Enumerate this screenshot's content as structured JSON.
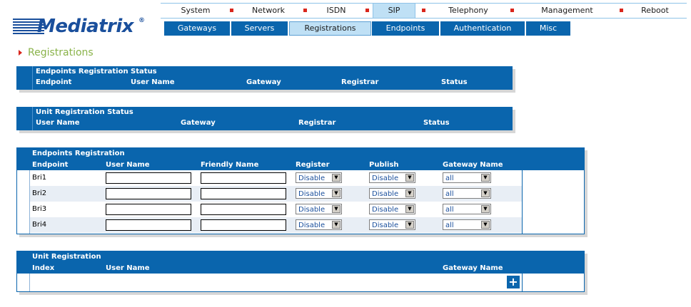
{
  "logo": {
    "text": "Mediatrix",
    "reg": "®"
  },
  "top_menu": [
    {
      "label": "System"
    },
    {
      "label": "Network"
    },
    {
      "label": "ISDN"
    },
    {
      "label": "SIP"
    },
    {
      "label": "Telephony"
    },
    {
      "label": "Management"
    },
    {
      "label": "Reboot"
    }
  ],
  "top_menu_active": "SIP",
  "sub_menu": [
    {
      "label": "Gateways"
    },
    {
      "label": "Servers"
    },
    {
      "label": "Registrations"
    },
    {
      "label": "Endpoints"
    },
    {
      "label": "Authentication"
    },
    {
      "label": "Misc"
    }
  ],
  "sub_menu_active": "Registrations",
  "page_title": "Registrations",
  "endpoints_status": {
    "title": "Endpoints Registration Status",
    "columns": [
      "Endpoint",
      "User Name",
      "Gateway",
      "Registrar",
      "Status"
    ]
  },
  "unit_status": {
    "title": "Unit Registration Status",
    "columns": [
      "User Name",
      "Gateway",
      "Registrar",
      "Status"
    ]
  },
  "endpoints_registration": {
    "title": "Endpoints Registration",
    "columns": [
      "Endpoint",
      "User Name",
      "Friendly Name",
      "Register",
      "Publish",
      "Gateway Name"
    ],
    "rows": [
      {
        "endpoint": "Bri1",
        "user_name": "",
        "friendly_name": "",
        "register": "Disable",
        "publish": "Disable",
        "gateway": "all"
      },
      {
        "endpoint": "Bri2",
        "user_name": "",
        "friendly_name": "",
        "register": "Disable",
        "publish": "Disable",
        "gateway": "all"
      },
      {
        "endpoint": "Bri3",
        "user_name": "",
        "friendly_name": "",
        "register": "Disable",
        "publish": "Disable",
        "gateway": "all"
      },
      {
        "endpoint": "Bri4",
        "user_name": "",
        "friendly_name": "",
        "register": "Disable",
        "publish": "Disable",
        "gateway": "all"
      }
    ]
  },
  "unit_registration": {
    "title": "Unit Registration",
    "columns": [
      "Index",
      "User Name",
      "Gateway Name"
    ],
    "add_label": "+"
  },
  "colors": {
    "primary": "#0a65ad",
    "active_tab": "#bfe0f5",
    "title": "#8ab34a",
    "separator": "#d9261c"
  }
}
